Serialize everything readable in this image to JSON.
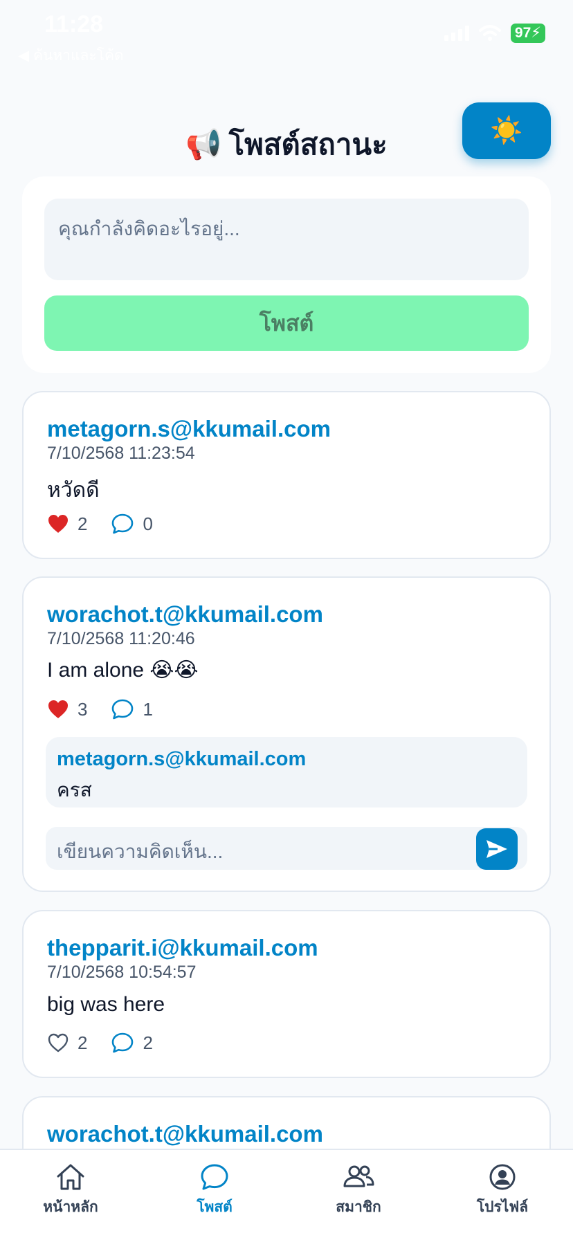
{
  "status_bar": {
    "time": "11:28",
    "back_label": "◀ ค้นหาและโค้ด",
    "battery": "97"
  },
  "header": {
    "emoji": "📢",
    "title": "โพสต์สถานะ",
    "theme_icon": "☀️"
  },
  "composer": {
    "placeholder": "คุณกำลังคิดอะไรอยู่...",
    "post_label": "โพสต์"
  },
  "posts": [
    {
      "author": "metagorn.s@kkumail.com",
      "date": "7/10/2568 11:23:54",
      "text": "หวัดดี",
      "liked": true,
      "likes": "2",
      "comments": "0"
    },
    {
      "author": "worachot.t@kkumail.com",
      "date": "7/10/2568 11:20:46",
      "text": "I am alone 😭😭",
      "liked": true,
      "likes": "3",
      "comments": "1",
      "comment_list": [
        {
          "author": "metagorn.s@kkumail.com",
          "text": "ครส"
        }
      ],
      "comment_placeholder": "เขียนความคิดเห็น..."
    },
    {
      "author": "thepparit.i@kkumail.com",
      "date": "7/10/2568 10:54:57",
      "text": "big was here",
      "liked": false,
      "likes": "2",
      "comments": "2"
    },
    {
      "author": "worachot.t@kkumail.com"
    }
  ],
  "nav": {
    "items": [
      {
        "label": "หน้าหลัก",
        "icon": "home-icon"
      },
      {
        "label": "โพสต์",
        "icon": "chat-icon",
        "active": true
      },
      {
        "label": "สมาชิก",
        "icon": "members-icon"
      },
      {
        "label": "โปรไฟล์",
        "icon": "profile-icon"
      }
    ]
  },
  "colors": {
    "accent": "#0284c7",
    "post_button": "#7ef5b2",
    "heart": "#dc2626",
    "background": "#f8fafc"
  }
}
